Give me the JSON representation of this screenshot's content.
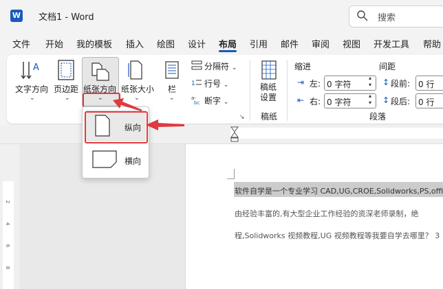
{
  "app": {
    "title": "文档1  -  Word",
    "logo_letter": "W"
  },
  "search": {
    "label": "搜索"
  },
  "tabs": [
    "文件",
    "开始",
    "我的模板",
    "插入",
    "绘图",
    "设计",
    "布局",
    "引用",
    "邮件",
    "审阅",
    "视图",
    "开发工具",
    "帮助"
  ],
  "active_tab": "布局",
  "ribbon": {
    "text_direction": "文字方向",
    "margins": "页边距",
    "orientation": "纸张方向",
    "size": "纸张大小",
    "columns": "栏",
    "breaks": "分隔符",
    "line_numbers": "行号",
    "hyphenation": "断字",
    "draft_settings": "稿纸\n设置",
    "draft_group": "稿纸",
    "indent": "缩进",
    "spacing": "间距",
    "left": "左:",
    "right": "右:",
    "before": "段前:",
    "after": "段后:",
    "indent_left_value": "0 字符",
    "indent_right_value": "0 字符",
    "before_value": "0 行",
    "after_value": "0 行",
    "paragraph_group": "段落"
  },
  "orientation_menu": {
    "portrait": "纵向",
    "landscape": "横向"
  },
  "ruler_left": [
    "2",
    "4",
    "6",
    "8"
  ],
  "document": {
    "line1": "软件自学是一个专业学习  CAD,UG,CROE,Solidworks,PS,offi",
    "line2": "由经验丰富的,有大型企业工作经验的资深老师录制，绝",
    "line3": "程,Solidworks 视频教程,UG 视频教程等我要自学去哪里？ 3"
  },
  "colors": {
    "accent": "#185abd",
    "highlight_red": "#e0393e",
    "text_highlight": "#c8c8c8"
  }
}
